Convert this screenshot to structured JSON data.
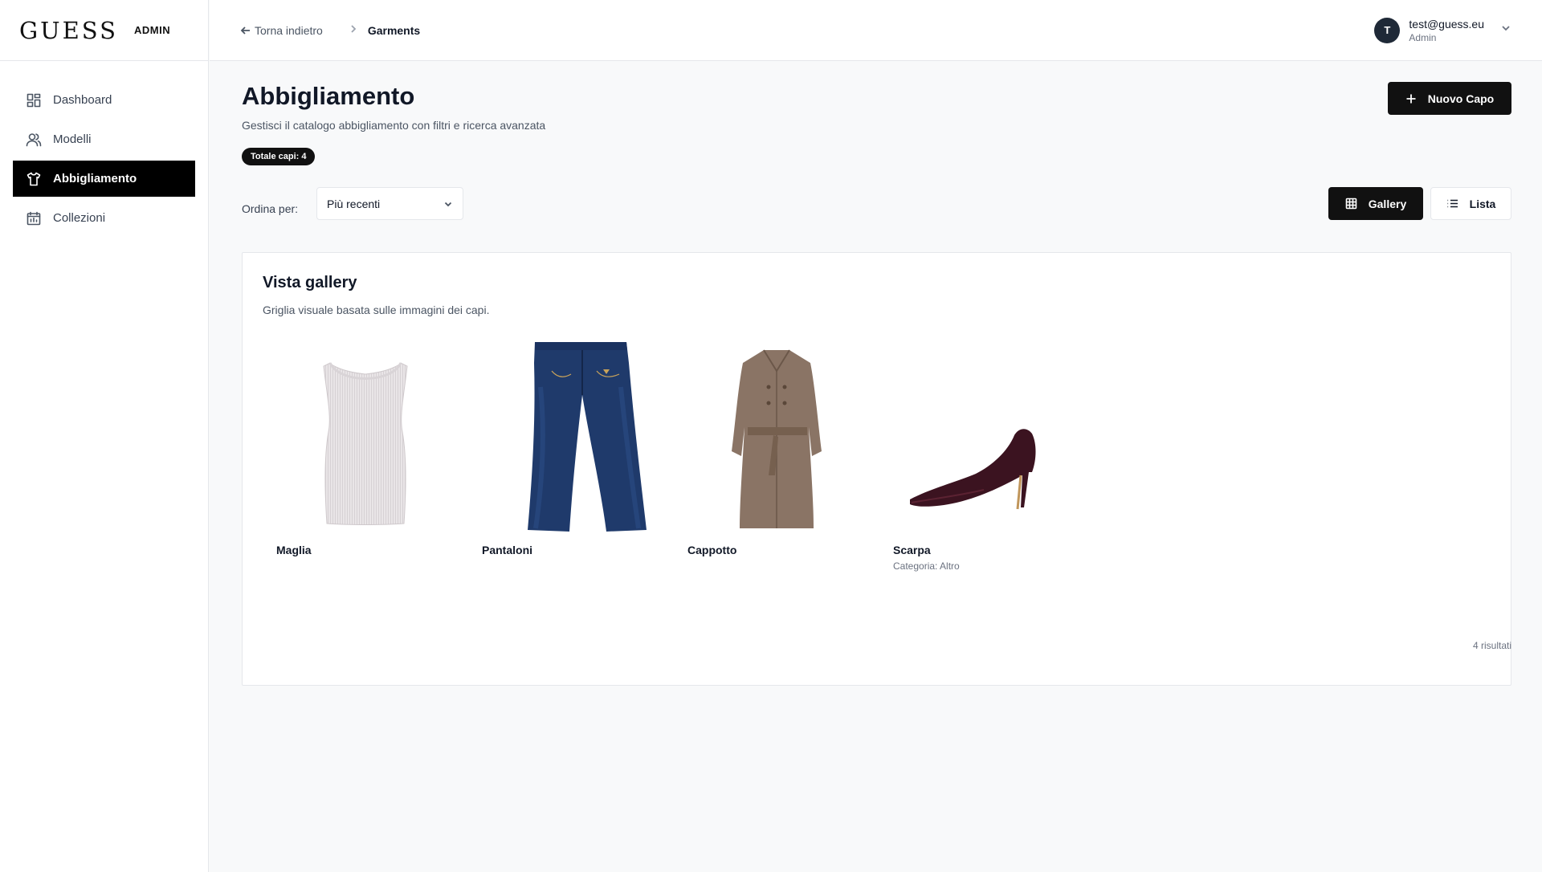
{
  "brand": {
    "logo": "GUESS",
    "badge": "ADMIN"
  },
  "sidebar": {
    "items": [
      {
        "label": "Dashboard",
        "icon": "dashboard-icon",
        "active": false
      },
      {
        "label": "Modelli",
        "icon": "users-icon",
        "active": false
      },
      {
        "label": "Abbigliamento",
        "icon": "shirt-icon",
        "active": true
      },
      {
        "label": "Collezioni",
        "icon": "collections-icon",
        "active": false
      }
    ]
  },
  "header": {
    "back_label": "Torna indietro",
    "current": "Garments",
    "user": {
      "initial": "T",
      "email": "test@guess.eu",
      "role": "Admin"
    }
  },
  "page": {
    "title": "Abbigliamento",
    "subtitle": "Gestisci il catalogo abbigliamento con filtri e ricerca avanzata",
    "total_badge": "Totale capi: 4",
    "new_button": "Nuovo Capo"
  },
  "toolbar": {
    "sort_label": "Ordina per:",
    "sort_value": "Più recenti",
    "view_gallery": "Gallery",
    "view_list": "Lista",
    "active_view": "gallery"
  },
  "gallery": {
    "title": "Vista gallery",
    "subtitle": "Griglia visuale basata sulle immagini dei capi.",
    "items": [
      {
        "name": "Maglia",
        "category": "",
        "image": "tank-top-image"
      },
      {
        "name": "Pantaloni",
        "category": "",
        "image": "jeans-image"
      },
      {
        "name": "Cappotto",
        "category": "",
        "image": "trench-coat-image"
      },
      {
        "name": "Scarpa",
        "category": "Categoria: Altro",
        "image": "pump-shoe-image"
      }
    ]
  },
  "results": "4 risultati",
  "colors": {
    "accent": "#111111",
    "background": "#f8f9fa",
    "surface": "#ffffff",
    "border": "#e5e7eb"
  }
}
